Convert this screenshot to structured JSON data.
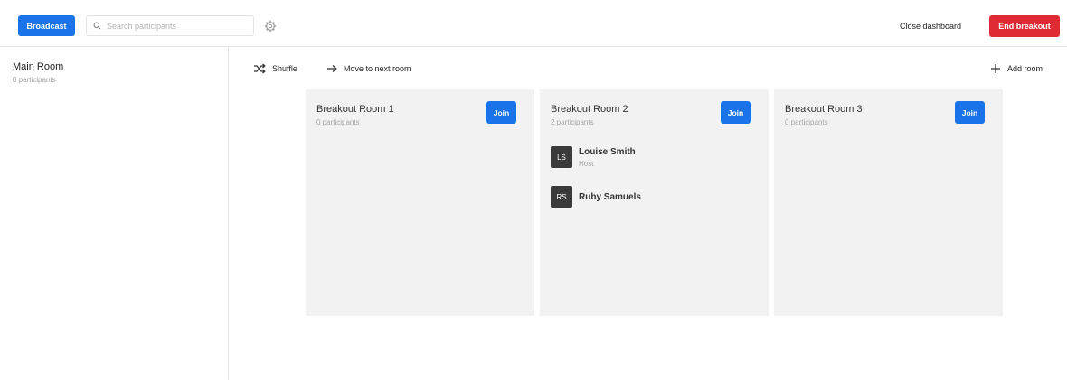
{
  "header": {
    "broadcast_label": "Broadcast",
    "search_placeholder": "Search participants",
    "close_dashboard_label": "Close dashboard",
    "end_breakout_label": "End breakout"
  },
  "main_room": {
    "title": "Main Room",
    "subtitle": "0 participants"
  },
  "toolbar": {
    "shuffle_label": "Shuffle",
    "move_label": "Move to next room",
    "add_room_label": "Add room"
  },
  "rooms": [
    {
      "title": "Breakout Room 1",
      "subtitle": "0 participants",
      "join_label": "Join",
      "participants": []
    },
    {
      "title": "Breakout Room 2",
      "subtitle": "2 participants",
      "join_label": "Join",
      "participants": [
        {
          "initials": "LS",
          "name": "Louise Smith",
          "role": "Host"
        },
        {
          "initials": "RS",
          "name": "Ruby Samuels",
          "role": ""
        }
      ]
    },
    {
      "title": "Breakout Room 3",
      "subtitle": "0 participants",
      "join_label": "Join",
      "participants": []
    }
  ],
  "colors": {
    "primary": "#1a73e8",
    "danger": "#e02b35",
    "room_bg": "#f2f2f2"
  },
  "icons": {
    "search": "search-icon",
    "settings": "gear-icon",
    "shuffle": "shuffle-icon",
    "move": "arrow-right-icon",
    "add": "plus-icon"
  }
}
